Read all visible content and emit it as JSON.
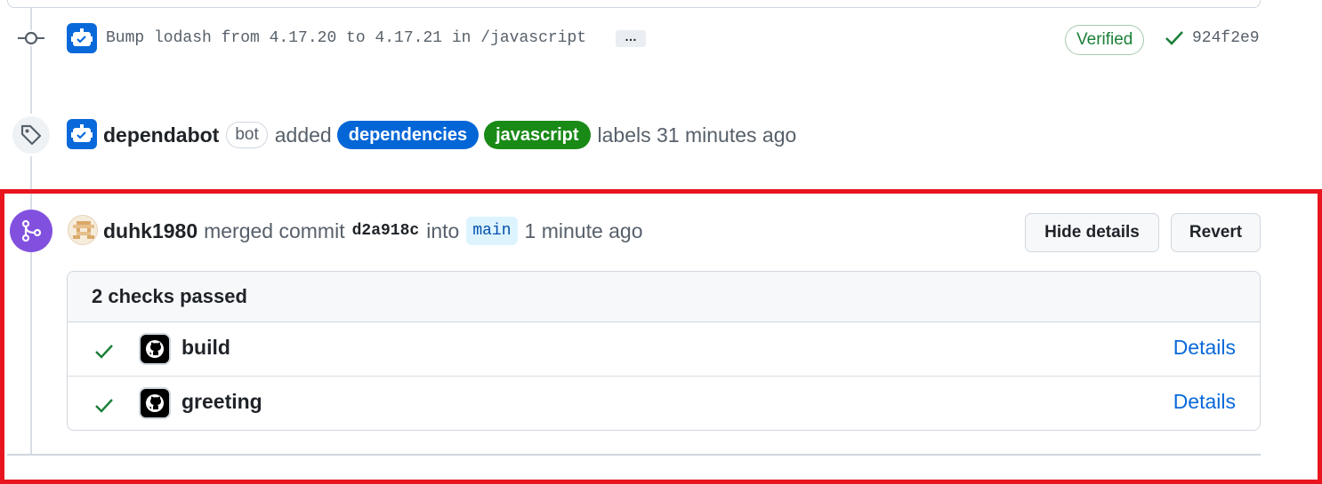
{
  "commit": {
    "message": "Bump lodash from 4.17.20 to 4.17.21 in /javascript",
    "ellipsis": "…",
    "verified_label": "Verified",
    "sha": "924f2e9"
  },
  "label_event": {
    "user": "dependabot",
    "bot_badge": "bot",
    "action": "added",
    "labels": [
      "dependencies",
      "javascript"
    ],
    "suffix": "labels 31 minutes ago"
  },
  "merge_event": {
    "user": "duhk1980",
    "action": "merged commit",
    "commit_sha": "d2a918c",
    "into": "into",
    "branch": "main",
    "time": "1 minute ago",
    "hide_details_label": "Hide details",
    "revert_label": "Revert"
  },
  "checks": {
    "header": "2 checks passed",
    "items": [
      {
        "name": "build",
        "link": "Details"
      },
      {
        "name": "greeting",
        "link": "Details"
      }
    ]
  },
  "colors": {
    "accent_blue": "#0969da",
    "merge_purple": "#8250df",
    "success_green": "#1a7f37",
    "label_dependencies": "#0366d6",
    "label_javascript": "#1a8a17",
    "highlight_red": "#e8141e"
  },
  "icons": {
    "commit": "git-commit-icon",
    "bot_avatar": "dependabot-icon",
    "check": "check-icon",
    "tag": "tag-icon",
    "merge": "git-merge-icon",
    "github": "github-mark-icon"
  }
}
